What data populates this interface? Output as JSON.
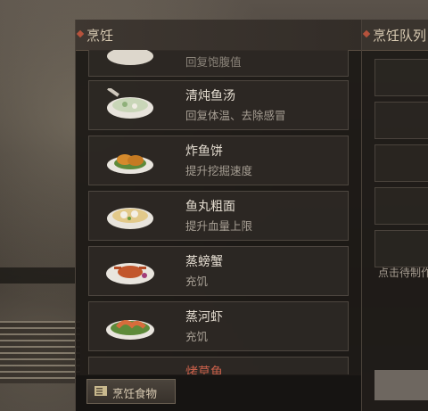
{
  "cooking_panel": {
    "title": "烹饪"
  },
  "recipes": [
    {
      "name": "回复饱腹值",
      "desc": ""
    },
    {
      "name": "清炖鱼汤",
      "desc": "回复体温、去除感冒"
    },
    {
      "name": "炸鱼饼",
      "desc": "提升挖掘速度"
    },
    {
      "name": "鱼丸粗面",
      "desc": "提升血量上限"
    },
    {
      "name": "蒸螃蟹",
      "desc": "充饥"
    },
    {
      "name": "蒸河虾",
      "desc": "充饥"
    },
    {
      "name": "烤草鱼",
      "desc": ""
    }
  ],
  "cook_food_button": {
    "label": "烹饪食物"
  },
  "queue_panel": {
    "title": "烹饪队列",
    "hint": "点击待制作"
  },
  "colors": {
    "accent": "#b5523c",
    "panel": "#1c1916",
    "text": "#e4dcd0"
  }
}
